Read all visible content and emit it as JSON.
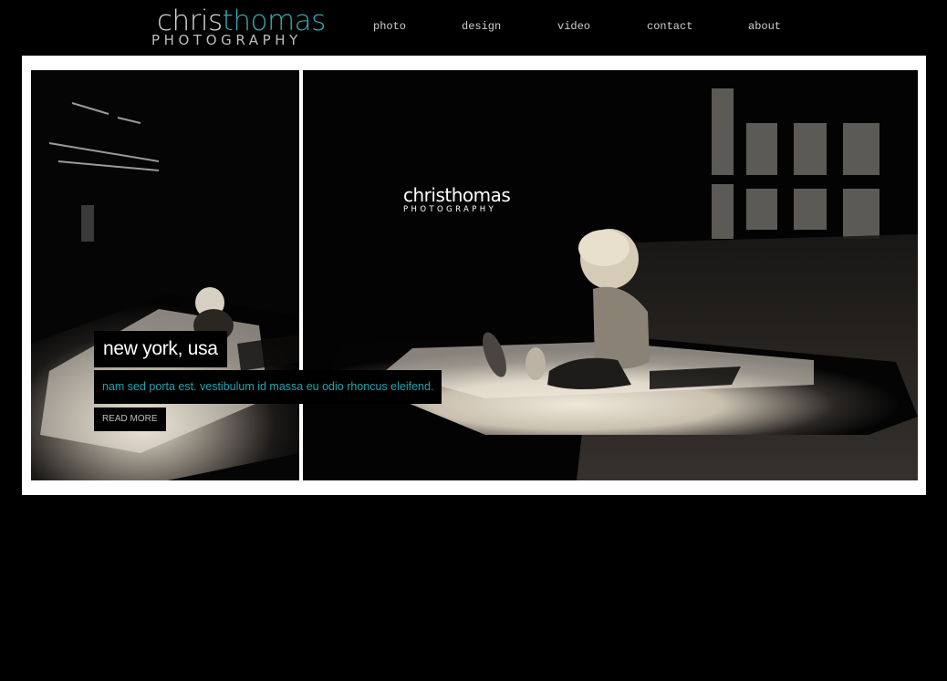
{
  "header": {
    "logo": {
      "first": "chris",
      "second": "thomas",
      "tagline": "PHOTOGRAPHY"
    },
    "nav": [
      {
        "label": "photo"
      },
      {
        "label": "design"
      },
      {
        "label": "video"
      },
      {
        "label": "contact"
      },
      {
        "label": "about"
      }
    ]
  },
  "slide": {
    "watermark": {
      "name": "christhomas",
      "tagline": "PHOTOGRAPHY"
    },
    "title": "new york, usa",
    "description": "nam sed porta est. vestibulum id massa eu odio rhoncus eleifend.",
    "read_more": "READ MORE"
  },
  "colors": {
    "accent": "#2aa0ab",
    "background": "#000000",
    "frame": "#ffffff"
  }
}
